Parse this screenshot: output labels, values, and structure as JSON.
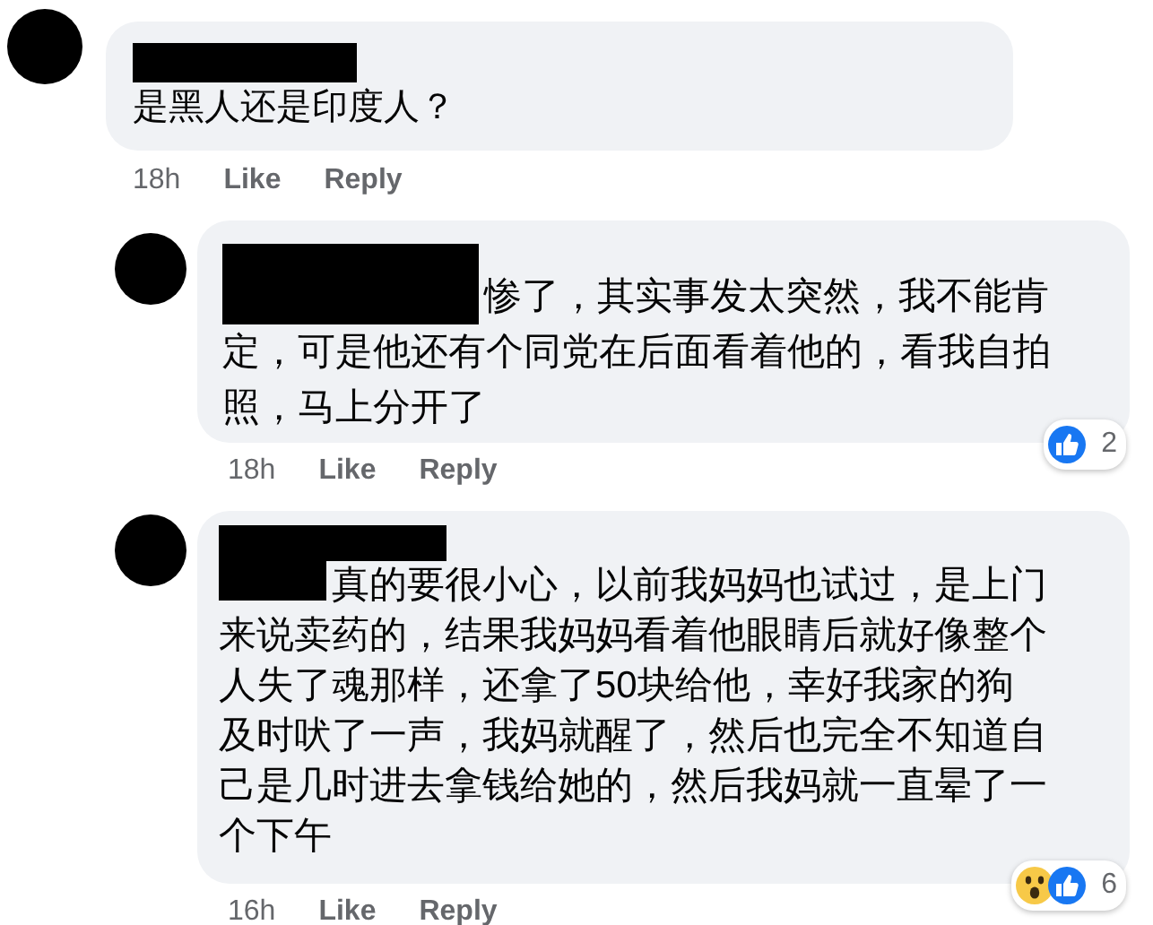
{
  "comment": {
    "text": "是黑人还是印度人？",
    "time": "18h",
    "actions": [
      "Like",
      "Reply"
    ],
    "replies": [
      {
        "text": "惨了，其实事发太突然，我不能肯定，可是他还有个同党在后面看着他的，看我自拍照，马上分开了",
        "time": "18h",
        "actions": [
          "Like",
          "Reply"
        ],
        "reactions": [
          {
            "kind": "like"
          }
        ],
        "reaction_count": "2"
      },
      {
        "text": "真的要很小心，以前我妈妈也试过，是上门来说卖药的，结果我妈妈看着他眼睛后就好像整个人失了魂那样，还拿了50块给他，幸好我家的狗及时吠了一声，我妈就醒了，然后也完全不知道自己是几时进去拿钱给她的，然后我妈就一直晕了一个下午",
        "time": "16h",
        "actions": [
          "Like",
          "Reply"
        ],
        "reactions": [
          {
            "kind": "wow"
          },
          {
            "kind": "like"
          }
        ],
        "reaction_count": "6"
      }
    ]
  }
}
